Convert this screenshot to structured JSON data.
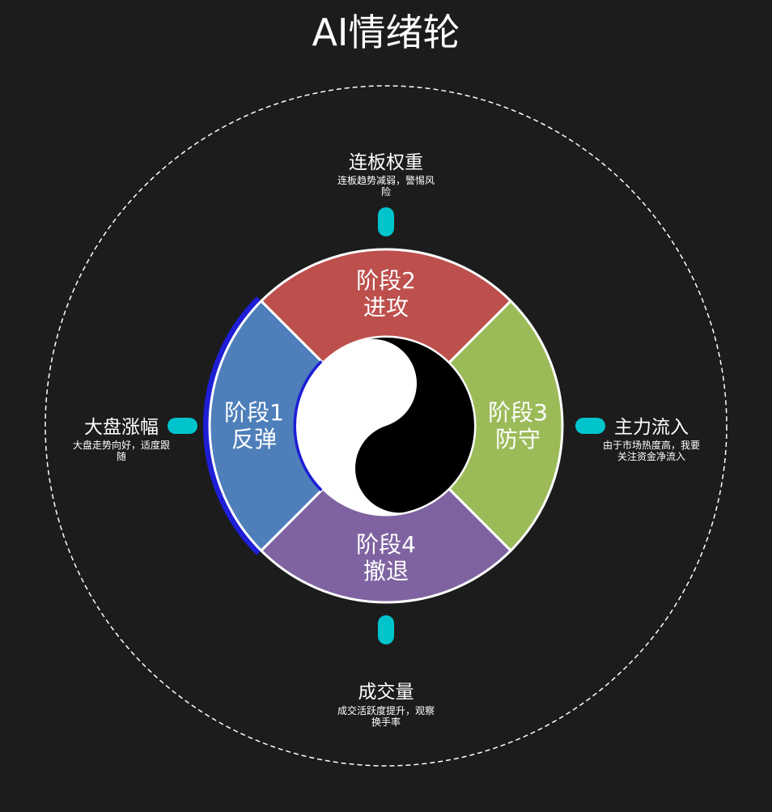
{
  "title": "AI情绪轮",
  "segments": [
    {
      "line1": "阶段1",
      "line2": "反弹",
      "color": "#4e7fba",
      "active": true
    },
    {
      "line1": "阶段2",
      "line2": "进攻",
      "color": "#bd4f4d"
    },
    {
      "line1": "阶段3",
      "line2": "防守",
      "color": "#9bbb59"
    },
    {
      "line1": "阶段4",
      "line2": "撤退",
      "color": "#7f63a1"
    }
  ],
  "indicators": {
    "top": {
      "title": "连板权重",
      "desc_line1": "连板趋势减弱，警惕风",
      "desc_line2": "险"
    },
    "left": {
      "title": "大盘涨幅",
      "desc_line1": "大盘走势向好，适度跟",
      "desc_line2": "随"
    },
    "right": {
      "title": "主力流入",
      "desc_line1": "由于市场热度高，我要",
      "desc_line2": "关注资金净流入"
    },
    "bottom": {
      "title": "成交量",
      "desc_line1": "成交活跃度提升，观察",
      "desc_line2": "换手率"
    }
  },
  "colors": {
    "background": "#1c1c1c",
    "highlight_arc": "#1e1ed6",
    "marker": "#00c4cc",
    "outline": "#ffffff"
  }
}
